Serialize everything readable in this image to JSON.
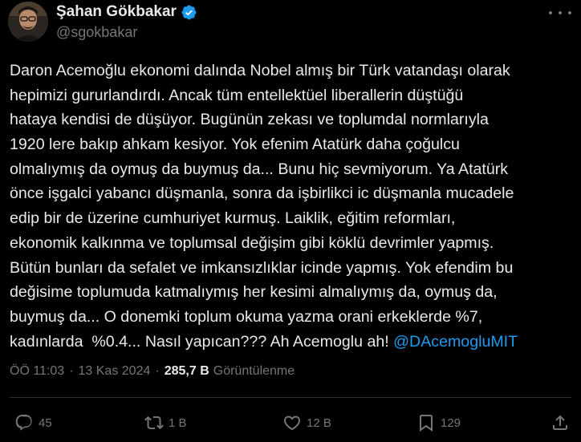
{
  "author": {
    "display_name": "Şahan Gökbakar",
    "handle": "@sgokbakar",
    "verified": true
  },
  "tweet": {
    "lines": [
      "Daron Acemoğlu ekonomi dalında Nobel almış bir Türk vatandaşı olarak",
      "hepimizi gururlandırdı. Ancak tüm entellektüel liberallerin düştüğü",
      "hataya kendisi de düşüyor. Bugünün zekası ve toplumdal normlarıyla",
      "1920 lere bakıp ahkam kesiyor. Yok efenim Atatürk daha çoğulcu",
      "olmalıymış da oymuş da buymuş da... Bunu hiç sevmiyorum. Ya Atatürk",
      "önce işgalci yabancı düşmanla, sonra da işbirlikci ic düşmanla mucadele",
      "edip bir de üzerine cumhuriyet kurmuş. Laiklik, eğitim reformları,",
      "ekonomik kalkınma ve toplumsal değişim gibi köklü devrimler yapmış.",
      "Bütün bunları da sefalet ve imkansızlıklar icinde yapmış. Yok efendim bu",
      "değisime toplumuda katmalıymış her kesimi almalıymış da, oymuş da,",
      "buymuş da... O donemki toplum okuma yazma orani erkeklerde %7,"
    ],
    "last_line_text": "kadınlarda  %0.4... Nasıl yapıcan??? Ah Acemoglu ah! ",
    "mention": "@DAcemogluMIT"
  },
  "meta": {
    "time": "ÖÖ 11:03",
    "separator": "·",
    "date": "13 Kas 2024",
    "views_count": "285,7 B",
    "views_label": "Görüntülenme"
  },
  "actions": {
    "reply_count": "45",
    "retweet_count": "1 B",
    "like_count": "12 B",
    "bookmark_count": "129"
  },
  "colors": {
    "background": "#000000",
    "text": "#e7e9ea",
    "muted": "#71767b",
    "accent": "#1d9bf0",
    "divider": "#2f3336"
  },
  "icons": {
    "verified": "verified-badge-icon",
    "more": "more-icon",
    "reply": "reply-icon",
    "retweet": "retweet-icon",
    "like": "heart-icon",
    "bookmark": "bookmark-icon",
    "share": "share-icon"
  }
}
